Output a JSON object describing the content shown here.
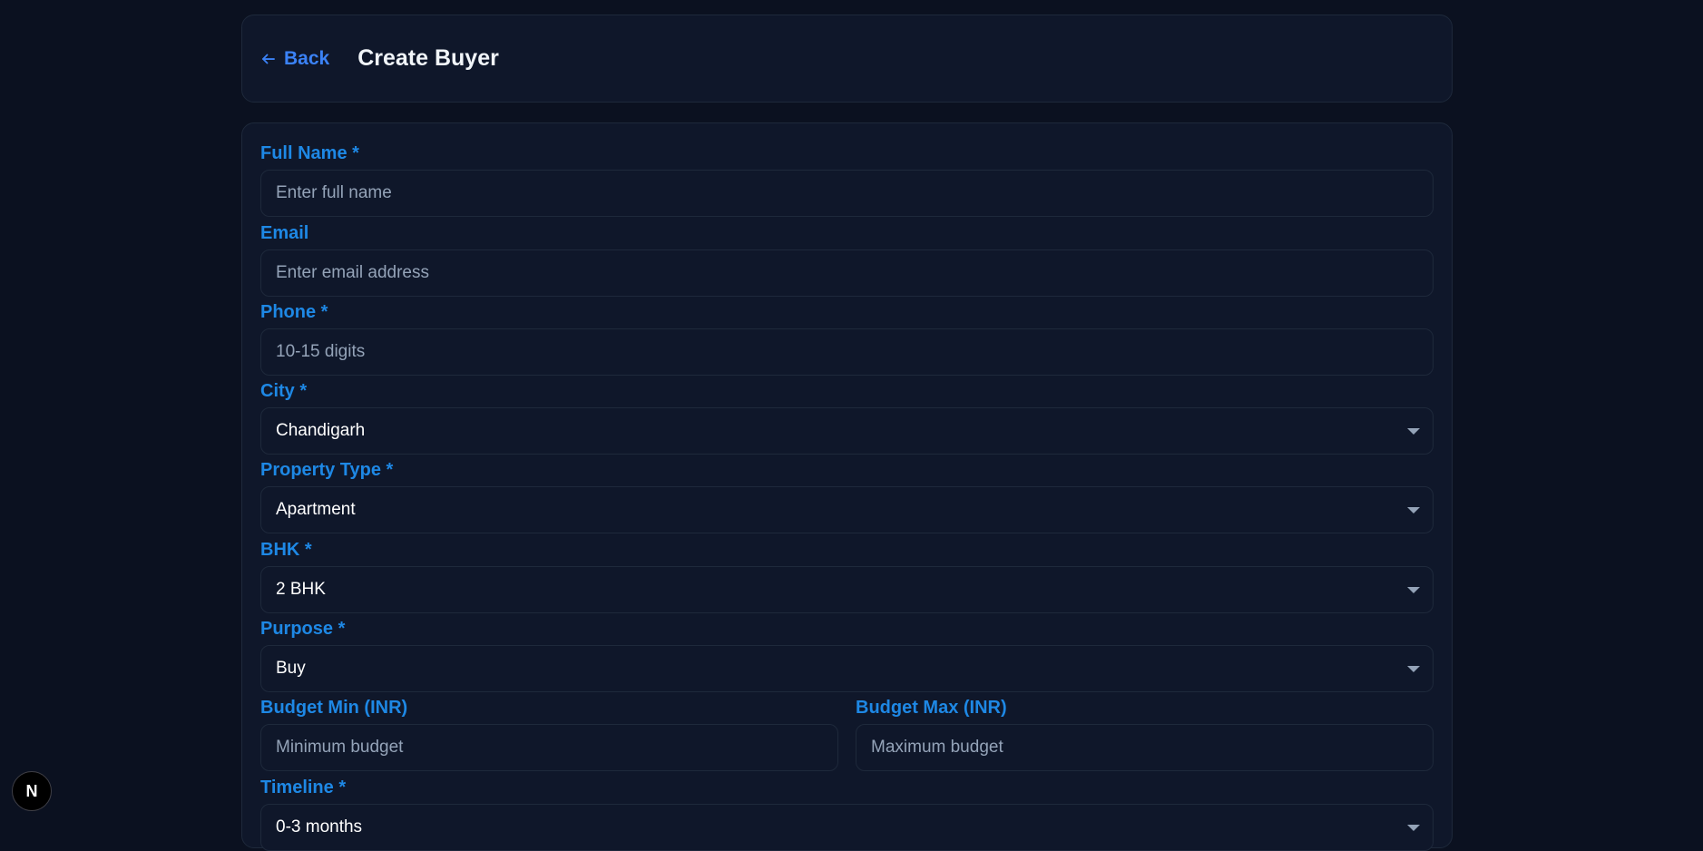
{
  "header": {
    "back_label": "Back",
    "title": "Create Buyer"
  },
  "form": {
    "full_name": {
      "label": "Full Name *",
      "placeholder": "Enter full name"
    },
    "email": {
      "label": "Email",
      "placeholder": "Enter email address"
    },
    "phone": {
      "label": "Phone *",
      "placeholder": "10-15 digits"
    },
    "city": {
      "label": "City *",
      "value": "Chandigarh"
    },
    "property_type": {
      "label": "Property Type *",
      "value": "Apartment"
    },
    "bhk": {
      "label": "BHK *",
      "value": "2 BHK"
    },
    "purpose": {
      "label": "Purpose *",
      "value": "Buy"
    },
    "budget_min": {
      "label": "Budget Min (INR)",
      "placeholder": "Minimum budget"
    },
    "budget_max": {
      "label": "Budget Max (INR)",
      "placeholder": "Maximum budget"
    },
    "timeline": {
      "label": "Timeline *",
      "value": "0-3 months"
    }
  },
  "badge": {
    "letter": "N"
  },
  "colors": {
    "background": "#0b1120",
    "card": "#0f172a",
    "border": "#1e293b",
    "label": "#1e88e5",
    "link": "#3b82f6"
  }
}
